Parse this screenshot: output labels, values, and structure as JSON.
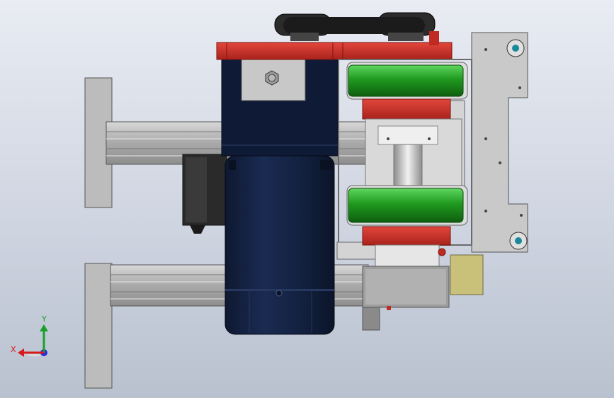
{
  "triad": {
    "x_label": "X",
    "y_label": "Y",
    "x_color": "#d81a1a",
    "y_color": "#19a02a",
    "z_color": "#2b2bd8"
  },
  "colors": {
    "background_top": "#e9ecf3",
    "background_bottom": "#b9c1cf",
    "motor_body": "#13213f",
    "aluminium_profile": "#b7b7b7",
    "bracket_red": "#d0342c",
    "wheel_green": "#1f9a1f",
    "plate_steel": "#c9c9c9",
    "gearbox_grey": "#9e9e9e",
    "block_khaki": "#c9c07a",
    "belt_black": "#1b1b1b"
  }
}
